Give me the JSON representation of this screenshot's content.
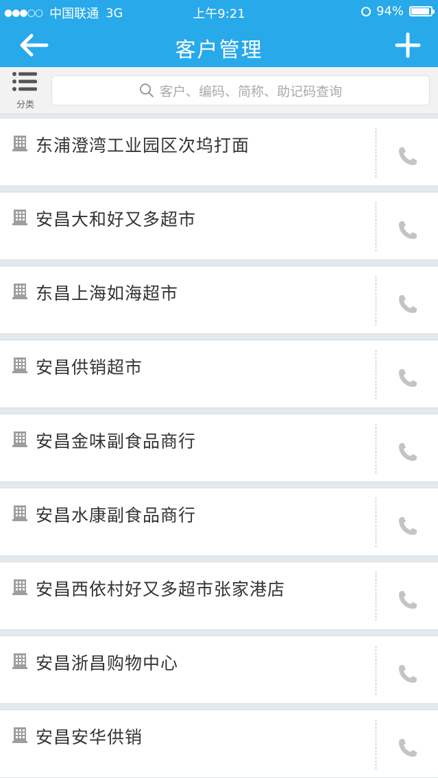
{
  "status_bar": {
    "signal": "●●●○○",
    "carrier": "中国联通",
    "network": "3G",
    "time": "上午9:21",
    "battery_text": "94%",
    "battery_level": 0.94
  },
  "nav": {
    "title": "客户管理",
    "back_icon": "arrow-left-icon",
    "add_icon": "plus-icon"
  },
  "search": {
    "category_label": "分类",
    "placeholder": "客户、编码、简称、助记码查询"
  },
  "customers": [
    {
      "name": "东浦澄湾工业园区次坞打面"
    },
    {
      "name": "安昌大和好又多超市"
    },
    {
      "name": "东昌上海如海超市"
    },
    {
      "name": "安昌供销超市"
    },
    {
      "name": "安昌金味副食品商行"
    },
    {
      "name": "安昌水康副食品商行"
    },
    {
      "name": "安昌西依村好又多超市张家港店"
    },
    {
      "name": "安昌浙昌购物中心"
    },
    {
      "name": "安昌安华供销"
    }
  ],
  "colors": {
    "brand": "#27a9ea",
    "icon_gray": "#a9a9a9"
  }
}
